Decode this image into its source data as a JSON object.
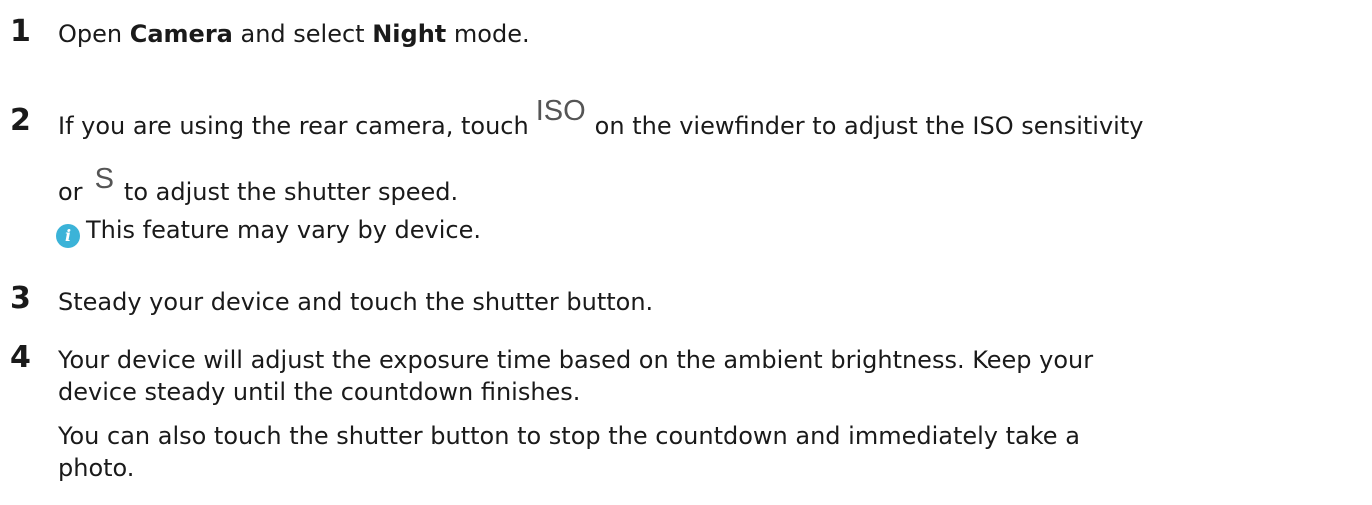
{
  "steps": [
    {
      "number": "1",
      "pre": "Open ",
      "bold1": "Camera",
      "mid": " and select ",
      "bold2": "Night",
      "post": " mode."
    },
    {
      "number": "2",
      "line1_pre": "If you are using the rear camera, touch",
      "iso_glyph": "ISO",
      "line1_post": "on the viewfinder to adjust the ISO sensitivity",
      "line2_pre": "or",
      "s_glyph": "S",
      "line2_post": "to adjust the shutter speed.",
      "note_icon": "info-icon",
      "note_icon_glyph": "i",
      "note_text": "This feature may vary by device."
    },
    {
      "number": "3",
      "text": "Steady your device and touch the shutter button."
    },
    {
      "number": "4",
      "line1": "Your device will adjust the exposure time based on the ambient brightness. Keep your",
      "line2": "device steady until the countdown finishes.",
      "line3": "You can also touch the shutter button to stop the countdown and immediately take a",
      "line4": "photo."
    }
  ],
  "colors": {
    "text": "#1a1a1a",
    "glyph": "#555555",
    "info_icon": "#3bb3d8"
  }
}
